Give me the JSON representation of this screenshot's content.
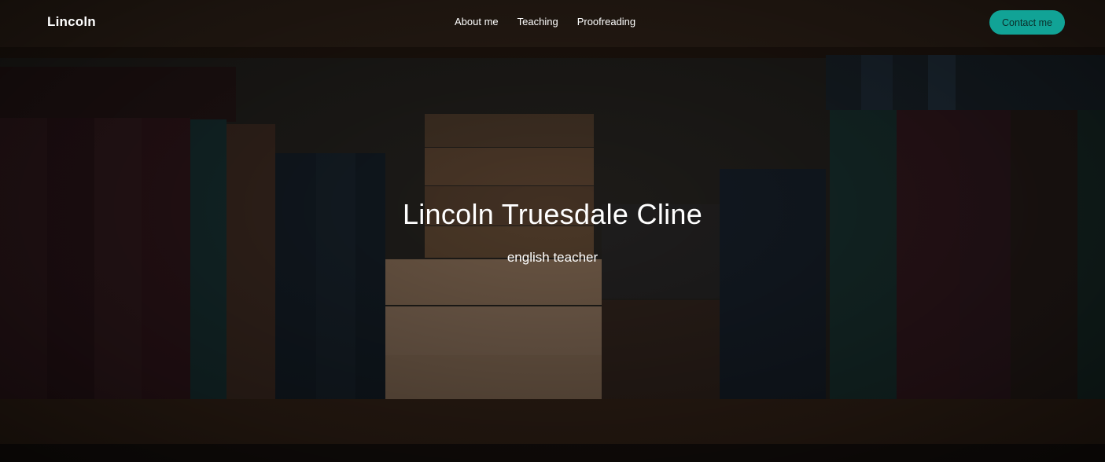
{
  "nav": {
    "brand": "Lincoln",
    "links": [
      "About me",
      "Teaching",
      "Proofreading"
    ],
    "cta": "Contact me",
    "accent_color": "#11a396"
  },
  "hero": {
    "title": "Lincoln Truesdale Cline",
    "subtitle": "english teacher",
    "background": "bookshelf-image"
  }
}
